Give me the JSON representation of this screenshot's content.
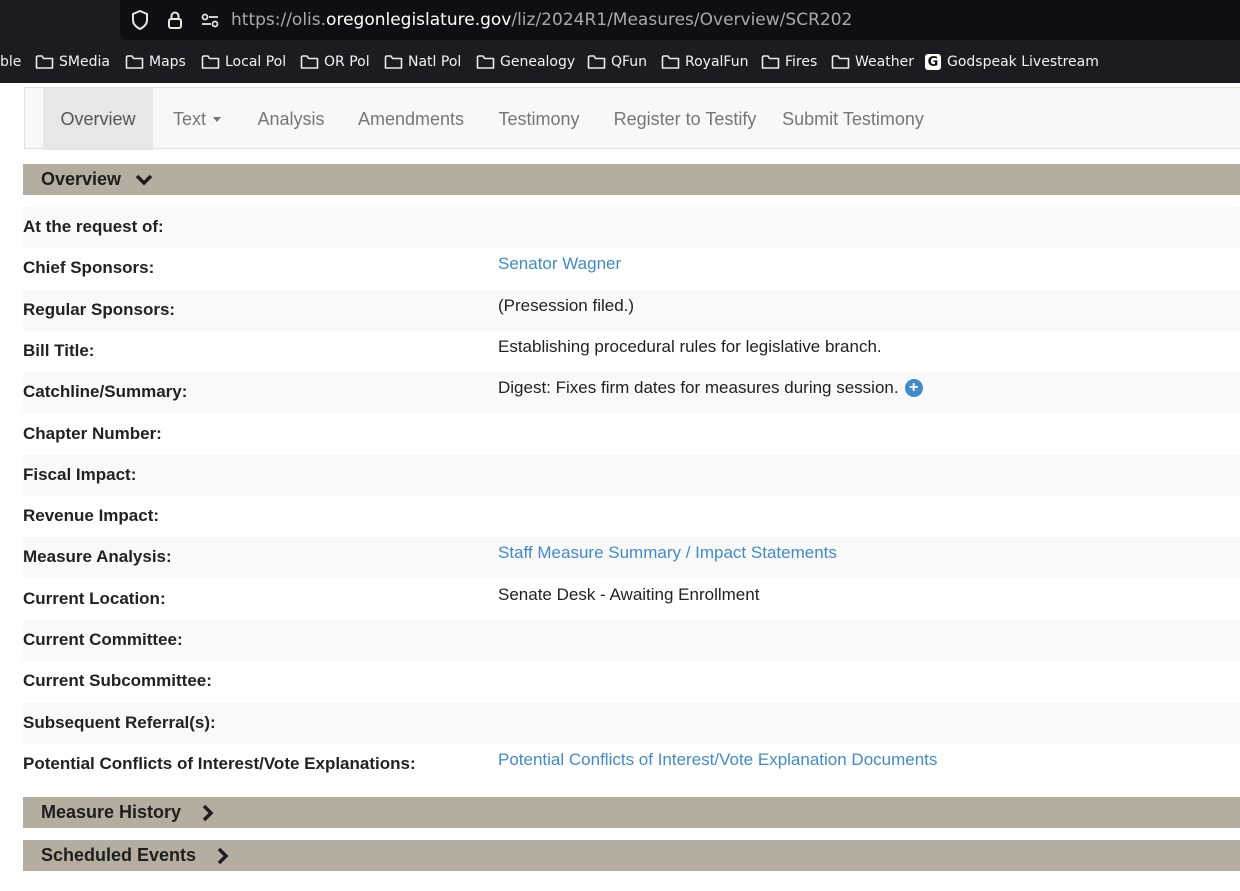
{
  "browser": {
    "url_prefix": "https://olis.",
    "url_domain": "oregonlegislature.gov",
    "url_path": "/liz/2024R1/Measures/Overview/SCR202",
    "bookmarks": [
      {
        "label": "ble",
        "icon": "none"
      },
      {
        "label": "SMedia",
        "icon": "folder-icon"
      },
      {
        "label": "Maps",
        "icon": "folder-icon"
      },
      {
        "label": "Local Pol",
        "icon": "folder-icon"
      },
      {
        "label": "OR Pol",
        "icon": "folder-icon"
      },
      {
        "label": "Natl Pol",
        "icon": "folder-icon"
      },
      {
        "label": "Genealogy",
        "icon": "folder-icon"
      },
      {
        "label": "QFun",
        "icon": "folder-icon"
      },
      {
        "label": "RoyalFun",
        "icon": "folder-icon"
      },
      {
        "label": "Fires",
        "icon": "folder-icon"
      },
      {
        "label": "Weather",
        "icon": "folder-icon"
      },
      {
        "label": "Godspeak Livestream",
        "icon": "g-logo-icon",
        "icon_letter": "G"
      }
    ]
  },
  "tabs": [
    {
      "label": "Overview",
      "active": true
    },
    {
      "label": "Text",
      "dropdown": true
    },
    {
      "label": "Analysis"
    },
    {
      "label": "Amendments"
    },
    {
      "label": "Testimony"
    },
    {
      "label": "Register to Testify"
    },
    {
      "label": "Submit Testimony"
    }
  ],
  "sections": {
    "overview": "Overview",
    "measure_history": "Measure History",
    "scheduled_events": "Scheduled Events"
  },
  "rows": [
    {
      "label": "At the request of:",
      "value": ""
    },
    {
      "label": "Chief Sponsors:",
      "value": "Senator Wagner",
      "link": true
    },
    {
      "label": "Regular Sponsors:",
      "value": "(Presession filed.)"
    },
    {
      "label": "Bill Title:",
      "value": "Establishing procedural rules for legislative branch."
    },
    {
      "label": "Catchline/Summary:",
      "value": "Digest: Fixes firm dates for measures during session.",
      "expand_icon": "plus-circle-icon"
    },
    {
      "label": "Chapter Number:",
      "value": ""
    },
    {
      "label": "Fiscal Impact:",
      "value": ""
    },
    {
      "label": "Revenue Impact:",
      "value": ""
    },
    {
      "label": "Measure Analysis:",
      "value": "Staff Measure Summary / Impact Statements",
      "link": true
    },
    {
      "label": "Current Location:",
      "value": "Senate Desk - Awaiting Enrollment"
    },
    {
      "label": "Current Committee:",
      "value": ""
    },
    {
      "label": "Current Subcommittee:",
      "value": ""
    },
    {
      "label": "Subsequent Referral(s):",
      "value": ""
    },
    {
      "label": "Potential Conflicts of Interest/Vote Explanations:",
      "value": "Potential Conflicts of Interest/Vote Explanation Documents",
      "link": true
    }
  ],
  "colors": {
    "link": "#428bca",
    "section_bar": "#b5aea0",
    "chrome_bg": "#1c1b22"
  }
}
